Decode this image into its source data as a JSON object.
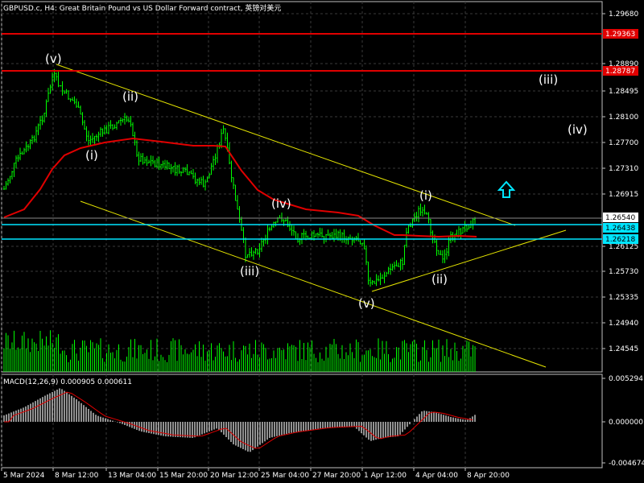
{
  "header": {
    "symbol_line": "GBPUSD.c, H4:  Great Britain Pound vs US Dollar Forward contract, 英镑对美元"
  },
  "macd": {
    "label": "MACD(12,26,9) 0.000905 0.000611",
    "yticks": [
      "0.005294",
      "0.000000",
      "-0.004674"
    ]
  },
  "price_axis": {
    "ticks": [
      "1.29680",
      "1.28890",
      "1.28495",
      "1.28100",
      "1.27700",
      "1.27310",
      "1.26915",
      "1.26125",
      "1.25730",
      "1.25335",
      "1.24940",
      "1.24545"
    ]
  },
  "price_tags": [
    {
      "name": "resistance-high-tag",
      "text": "1.29363",
      "color": "#e00000",
      "text_color": "#ffffff"
    },
    {
      "name": "resistance-low-tag",
      "text": "1.28787",
      "color": "#e00000",
      "text_color": "#ffffff"
    },
    {
      "name": "current-price-tag",
      "text": "1.26540",
      "color": "#ffffff",
      "text_color": "#000000"
    },
    {
      "name": "cyan-level-high-tag",
      "text": "1.26438",
      "color": "#00e5ff",
      "text_color": "#000000"
    },
    {
      "name": "cyan-level-low-tag",
      "text": "1.26218",
      "color": "#00e5ff",
      "text_color": "#000000"
    }
  ],
  "time_axis": {
    "ticks": [
      "5 Mar 2024",
      "8 Mar 12:00",
      "13 Mar 04:00",
      "15 Mar 20:00",
      "20 Mar 12:00",
      "25 Mar 04:00",
      "27 Mar 20:00",
      "1 Apr 12:00",
      "4 Apr 04:00",
      "8 Apr 20:00"
    ]
  },
  "wave_labels": [
    "(v)",
    "(ii)",
    "(i)",
    "(iv)",
    "(iii)",
    "(v)",
    "(i)",
    "(ii)",
    "(iii)",
    "(iv)"
  ],
  "colors": {
    "background": "#000000",
    "candles": "#00ff00",
    "moving_average": "#e00000",
    "channel": "#e6e600",
    "resistance": "#e00000",
    "support_lines": "#00e5ff",
    "arrow": "#00e5ff",
    "macd_histogram": "#c0c0c0",
    "macd_signal": "#e00000"
  },
  "icons": {
    "up_arrow": "up-arrow-icon"
  }
}
